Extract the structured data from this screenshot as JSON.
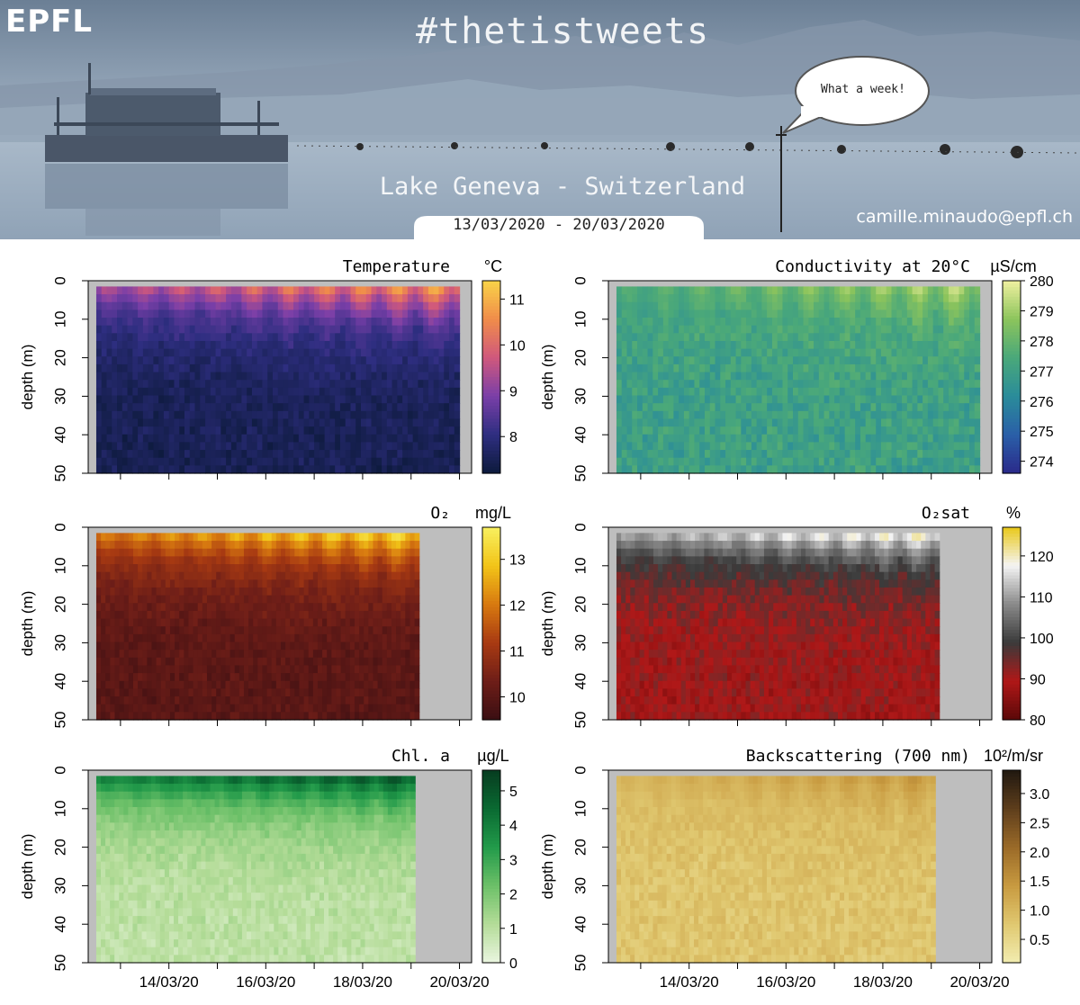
{
  "banner": {
    "logo": "EPFL",
    "hashtag": "#thetistweets",
    "speech": "What a week!",
    "location": "Lake Geneva - Switzerland",
    "daterange": "13/03/2020 - 20/03/2020",
    "email": "camille.minaudo@epfl.ch"
  },
  "colors": {
    "sky_top": "#6f8398",
    "sky_bottom": "#c3cfdc",
    "lake": "#9fb0c2",
    "gray_fill": "#bebebe"
  },
  "shared_axes": {
    "ylabel": "depth (m)",
    "yticks": [
      0,
      10,
      20,
      30,
      40,
      50
    ],
    "xticks": [
      "14/03/20",
      "16/03/20",
      "18/03/20",
      "20/03/20"
    ]
  },
  "chart_data": [
    {
      "type": "heatmap",
      "title": "Temperature",
      "unit": "°C",
      "ylim": [
        0,
        50
      ],
      "x_range": [
        "13/03/20",
        "20/03/20"
      ],
      "colorbar": {
        "ticks": [
          8,
          9,
          10,
          11
        ],
        "min": 7.2,
        "max": 11.4,
        "colors": [
          "#0d1a3c",
          "#2e2e80",
          "#7a3fa8",
          "#d0587c",
          "#f08c4a",
          "#f9d448"
        ]
      },
      "surface": {
        "min": 8.4,
        "max": 11.2
      },
      "bottom": {
        "min": 7.3,
        "max": 7.7
      },
      "no_data_from": null,
      "show_xticklabels": false
    },
    {
      "type": "heatmap",
      "title": "Conductivity at 20°C",
      "unit": "µS/cm",
      "ylim": [
        0,
        50
      ],
      "x_range": [
        "13/03/20",
        "20/03/20"
      ],
      "colorbar": {
        "ticks": [
          274,
          275,
          276,
          277,
          278,
          279,
          280
        ],
        "min": 273.6,
        "max": 280,
        "colors": [
          "#2a2a8a",
          "#2a5fa8",
          "#2a8c9a",
          "#4aa87a",
          "#8cc45c",
          "#f0f0a0"
        ]
      },
      "surface": {
        "min": 276.5,
        "max": 279.8
      },
      "bottom": {
        "min": 276.4,
        "max": 277.6
      },
      "no_data_from": null,
      "show_xticklabels": false
    },
    {
      "type": "heatmap",
      "title": "O₂",
      "unit": "mg/L",
      "ylim": [
        0,
        50
      ],
      "x_range": [
        "13/03/20",
        "20/03/20"
      ],
      "colorbar": {
        "ticks": [
          10,
          11,
          12,
          13
        ],
        "min": 9.5,
        "max": 13.7,
        "colors": [
          "#3a0e12",
          "#6e1e18",
          "#a83a12",
          "#d87a10",
          "#f2c418",
          "#f8f060"
        ]
      },
      "surface": {
        "min": 11.2,
        "max": 13.6
      },
      "bottom": {
        "min": 9.8,
        "max": 10.2
      },
      "no_data_from": "19/03/20 16:00",
      "show_xticklabels": false
    },
    {
      "type": "heatmap",
      "title": "O₂sat",
      "unit": "%",
      "ylim": [
        0,
        50
      ],
      "x_range": [
        "13/03/20",
        "20/03/20"
      ],
      "colorbar": {
        "ticks": [
          80,
          90,
          100,
          110,
          120
        ],
        "min": 80,
        "max": 127,
        "colors": [
          "#5a0808",
          "#b01818",
          "#3a3a3a",
          "#8a8a8a",
          "#f4f4f4",
          "#e8c818"
        ]
      },
      "surface": {
        "min": 104,
        "max": 123
      },
      "bottom": {
        "min": 86,
        "max": 93
      },
      "no_data_from": "19/03/20 16:00",
      "show_xticklabels": false
    },
    {
      "type": "heatmap",
      "title": "Chl. a",
      "unit": "µg/L",
      "ylim": [
        0,
        50
      ],
      "x_range": [
        "13/03/20",
        "20/03/20"
      ],
      "colorbar": {
        "ticks": [
          0,
          1,
          2,
          3,
          4,
          5
        ],
        "min": 0,
        "max": 5.6,
        "colors": [
          "#eaf6e0",
          "#b4dc98",
          "#6cc068",
          "#229a4a",
          "#0a6a32",
          "#073c20"
        ]
      },
      "surface": {
        "min": 3.2,
        "max": 5.3
      },
      "bottom": {
        "min": 0.6,
        "max": 1.2
      },
      "no_data_from": "19/03/20 14:00",
      "show_xticklabels": true
    },
    {
      "type": "heatmap",
      "title": "Backscattering (700 nm)",
      "unit": "10²/m/sr",
      "ylim": [
        0,
        50
      ],
      "x_range": [
        "13/03/20",
        "20/03/20"
      ],
      "colorbar": {
        "ticks": [
          0.5,
          1.0,
          1.5,
          2.0,
          2.5,
          3.0
        ],
        "min": 0.1,
        "max": 3.4,
        "colors": [
          "#f2ecb0",
          "#e0c870",
          "#c89a40",
          "#9a6a28",
          "#5e3e1c",
          "#201810"
        ]
      },
      "surface": {
        "min": 0.8,
        "max": 1.6
      },
      "bottom": {
        "min": 0.6,
        "max": 1.0
      },
      "no_data_from": "19/03/20 14:00",
      "show_xticklabels": true
    }
  ]
}
